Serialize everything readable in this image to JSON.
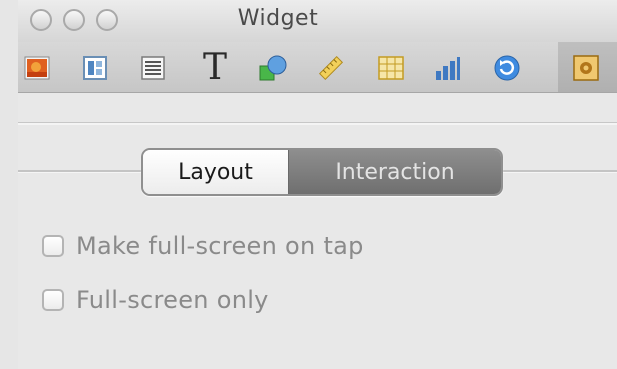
{
  "window": {
    "title": "Widget"
  },
  "toolbar": {
    "items": [
      {
        "name": "photo-icon"
      },
      {
        "name": "layout-icon"
      },
      {
        "name": "text-block-icon"
      },
      {
        "name": "text-icon",
        "glyph": "T"
      },
      {
        "name": "shapes-icon"
      },
      {
        "name": "ruler-icon"
      },
      {
        "name": "table-icon"
      },
      {
        "name": "chart-icon"
      },
      {
        "name": "refresh-icon"
      },
      {
        "name": "widget-icon",
        "selected": true
      }
    ]
  },
  "tabs": {
    "layout_label": "Layout",
    "interaction_label": "Interaction",
    "selected": "Interaction"
  },
  "options": {
    "fullscreen_on_tap": {
      "label": "Make full-screen on tap",
      "checked": false
    },
    "fullscreen_only": {
      "label": "Full-screen only",
      "checked": false
    }
  },
  "colors": {
    "accent_selected_tab": "#7f7f7f",
    "window_bg": "#e8e8e8"
  }
}
